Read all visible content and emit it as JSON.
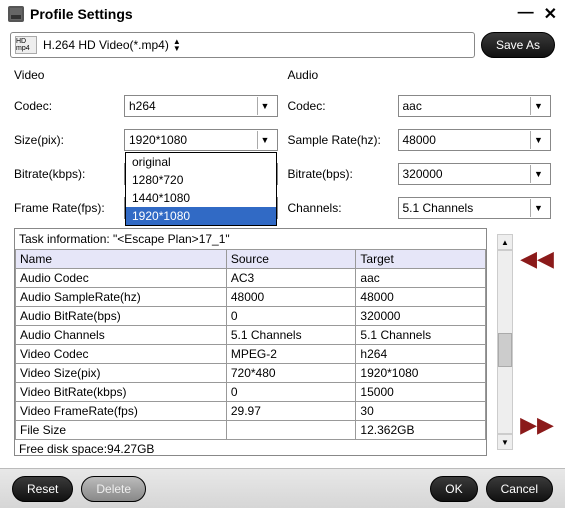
{
  "window": {
    "title": "Profile Settings"
  },
  "toolbar": {
    "profile_thumb": "HD mp4",
    "profile_name": "H.264 HD Video(*.mp4)",
    "saveas_label": "Save As"
  },
  "video": {
    "header": "Video",
    "codec_label": "Codec:",
    "codec_value": "h264",
    "size_label": "Size(pix):",
    "size_value": "1920*1080",
    "size_options": [
      "original",
      "1280*720",
      "1440*1080",
      "1920*1080"
    ],
    "size_selected_index": 3,
    "bitrate_label": "Bitrate(kbps):",
    "bitrate_value": "",
    "framerate_label": "Frame Rate(fps):",
    "framerate_value": ""
  },
  "audio": {
    "header": "Audio",
    "codec_label": "Codec:",
    "codec_value": "aac",
    "samplerate_label": "Sample Rate(hz):",
    "samplerate_value": "48000",
    "bitrate_label": "Bitrate(bps):",
    "bitrate_value": "320000",
    "channels_label": "Channels:",
    "channels_value": "5.1 Channels"
  },
  "task": {
    "caption": "Task information: \"<Escape Plan>17_1\"",
    "columns": [
      "Name",
      "Source",
      "Target"
    ],
    "rows": [
      {
        "name": "Audio Codec",
        "source": "AC3",
        "target": "aac"
      },
      {
        "name": "Audio SampleRate(hz)",
        "source": "48000",
        "target": "48000"
      },
      {
        "name": "Audio BitRate(bps)",
        "source": "0",
        "target": "320000"
      },
      {
        "name": "Audio Channels",
        "source": "5.1 Channels",
        "target": "5.1 Channels"
      },
      {
        "name": "Video Codec",
        "source": "MPEG-2",
        "target": "h264"
      },
      {
        "name": "Video Size(pix)",
        "source": "720*480",
        "target": "1920*1080"
      },
      {
        "name": "Video BitRate(kbps)",
        "source": "0",
        "target": "15000"
      },
      {
        "name": "Video FrameRate(fps)",
        "source": "29.97",
        "target": "30"
      },
      {
        "name": "File Size",
        "source": "",
        "target": "12.362GB"
      }
    ],
    "free_disk": "Free disk space:94.27GB"
  },
  "footer": {
    "reset": "Reset",
    "delete": "Delete",
    "ok": "OK",
    "cancel": "Cancel"
  }
}
